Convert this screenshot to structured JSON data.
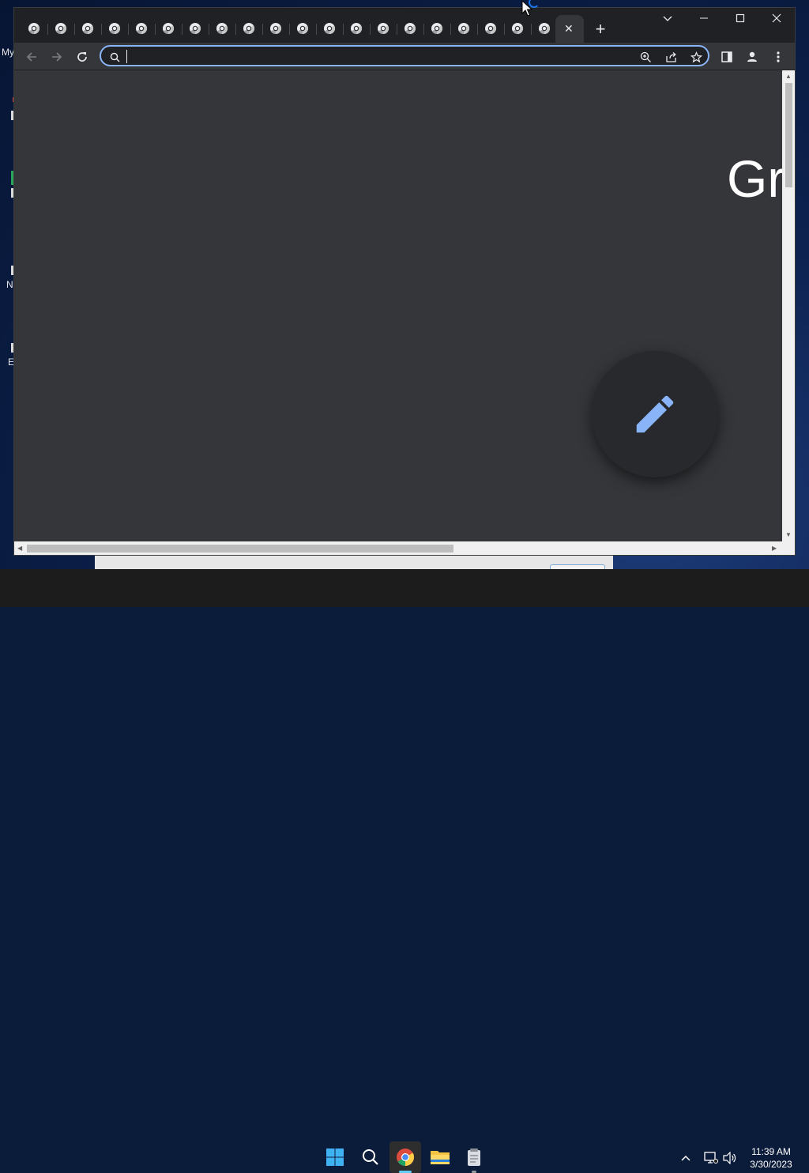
{
  "desktop": {
    "labels": [
      "My",
      "N",
      "E"
    ],
    "background_color": "#0d2250"
  },
  "browser": {
    "tab_count_inactive": 20,
    "active_tab": {
      "close_icon": "close-icon"
    },
    "new_tab_icon": "plus-icon",
    "window_controls": {
      "tab_search_icon": "chevron-down-icon",
      "minimize_icon": "minimize-icon",
      "maximize_icon": "maximize-icon",
      "close_icon": "close-icon"
    },
    "toolbar": {
      "back_icon": "arrow-left-icon",
      "forward_icon": "arrow-right-icon",
      "reload_icon": "reload-icon",
      "address_value": "",
      "side_panel_icon": "side-panel-icon",
      "profile_icon": "profile-icon",
      "menu_icon": "three-dot-menu-icon"
    },
    "omnibox_icons": [
      "search-icon",
      "zoom-icon",
      "share-icon",
      "star-icon"
    ],
    "accent_color": "#8ab4f8"
  },
  "page": {
    "greeting_text": "Gr",
    "fab_icon": "pencil-icon",
    "fab_icon_color": "#8ab4f8"
  },
  "taskbar": {
    "apps": [
      "windows-start",
      "search",
      "chrome",
      "file-explorer",
      "notepad"
    ],
    "clock": {
      "time": "11:39 AM",
      "date": "3/30/2023"
    }
  }
}
